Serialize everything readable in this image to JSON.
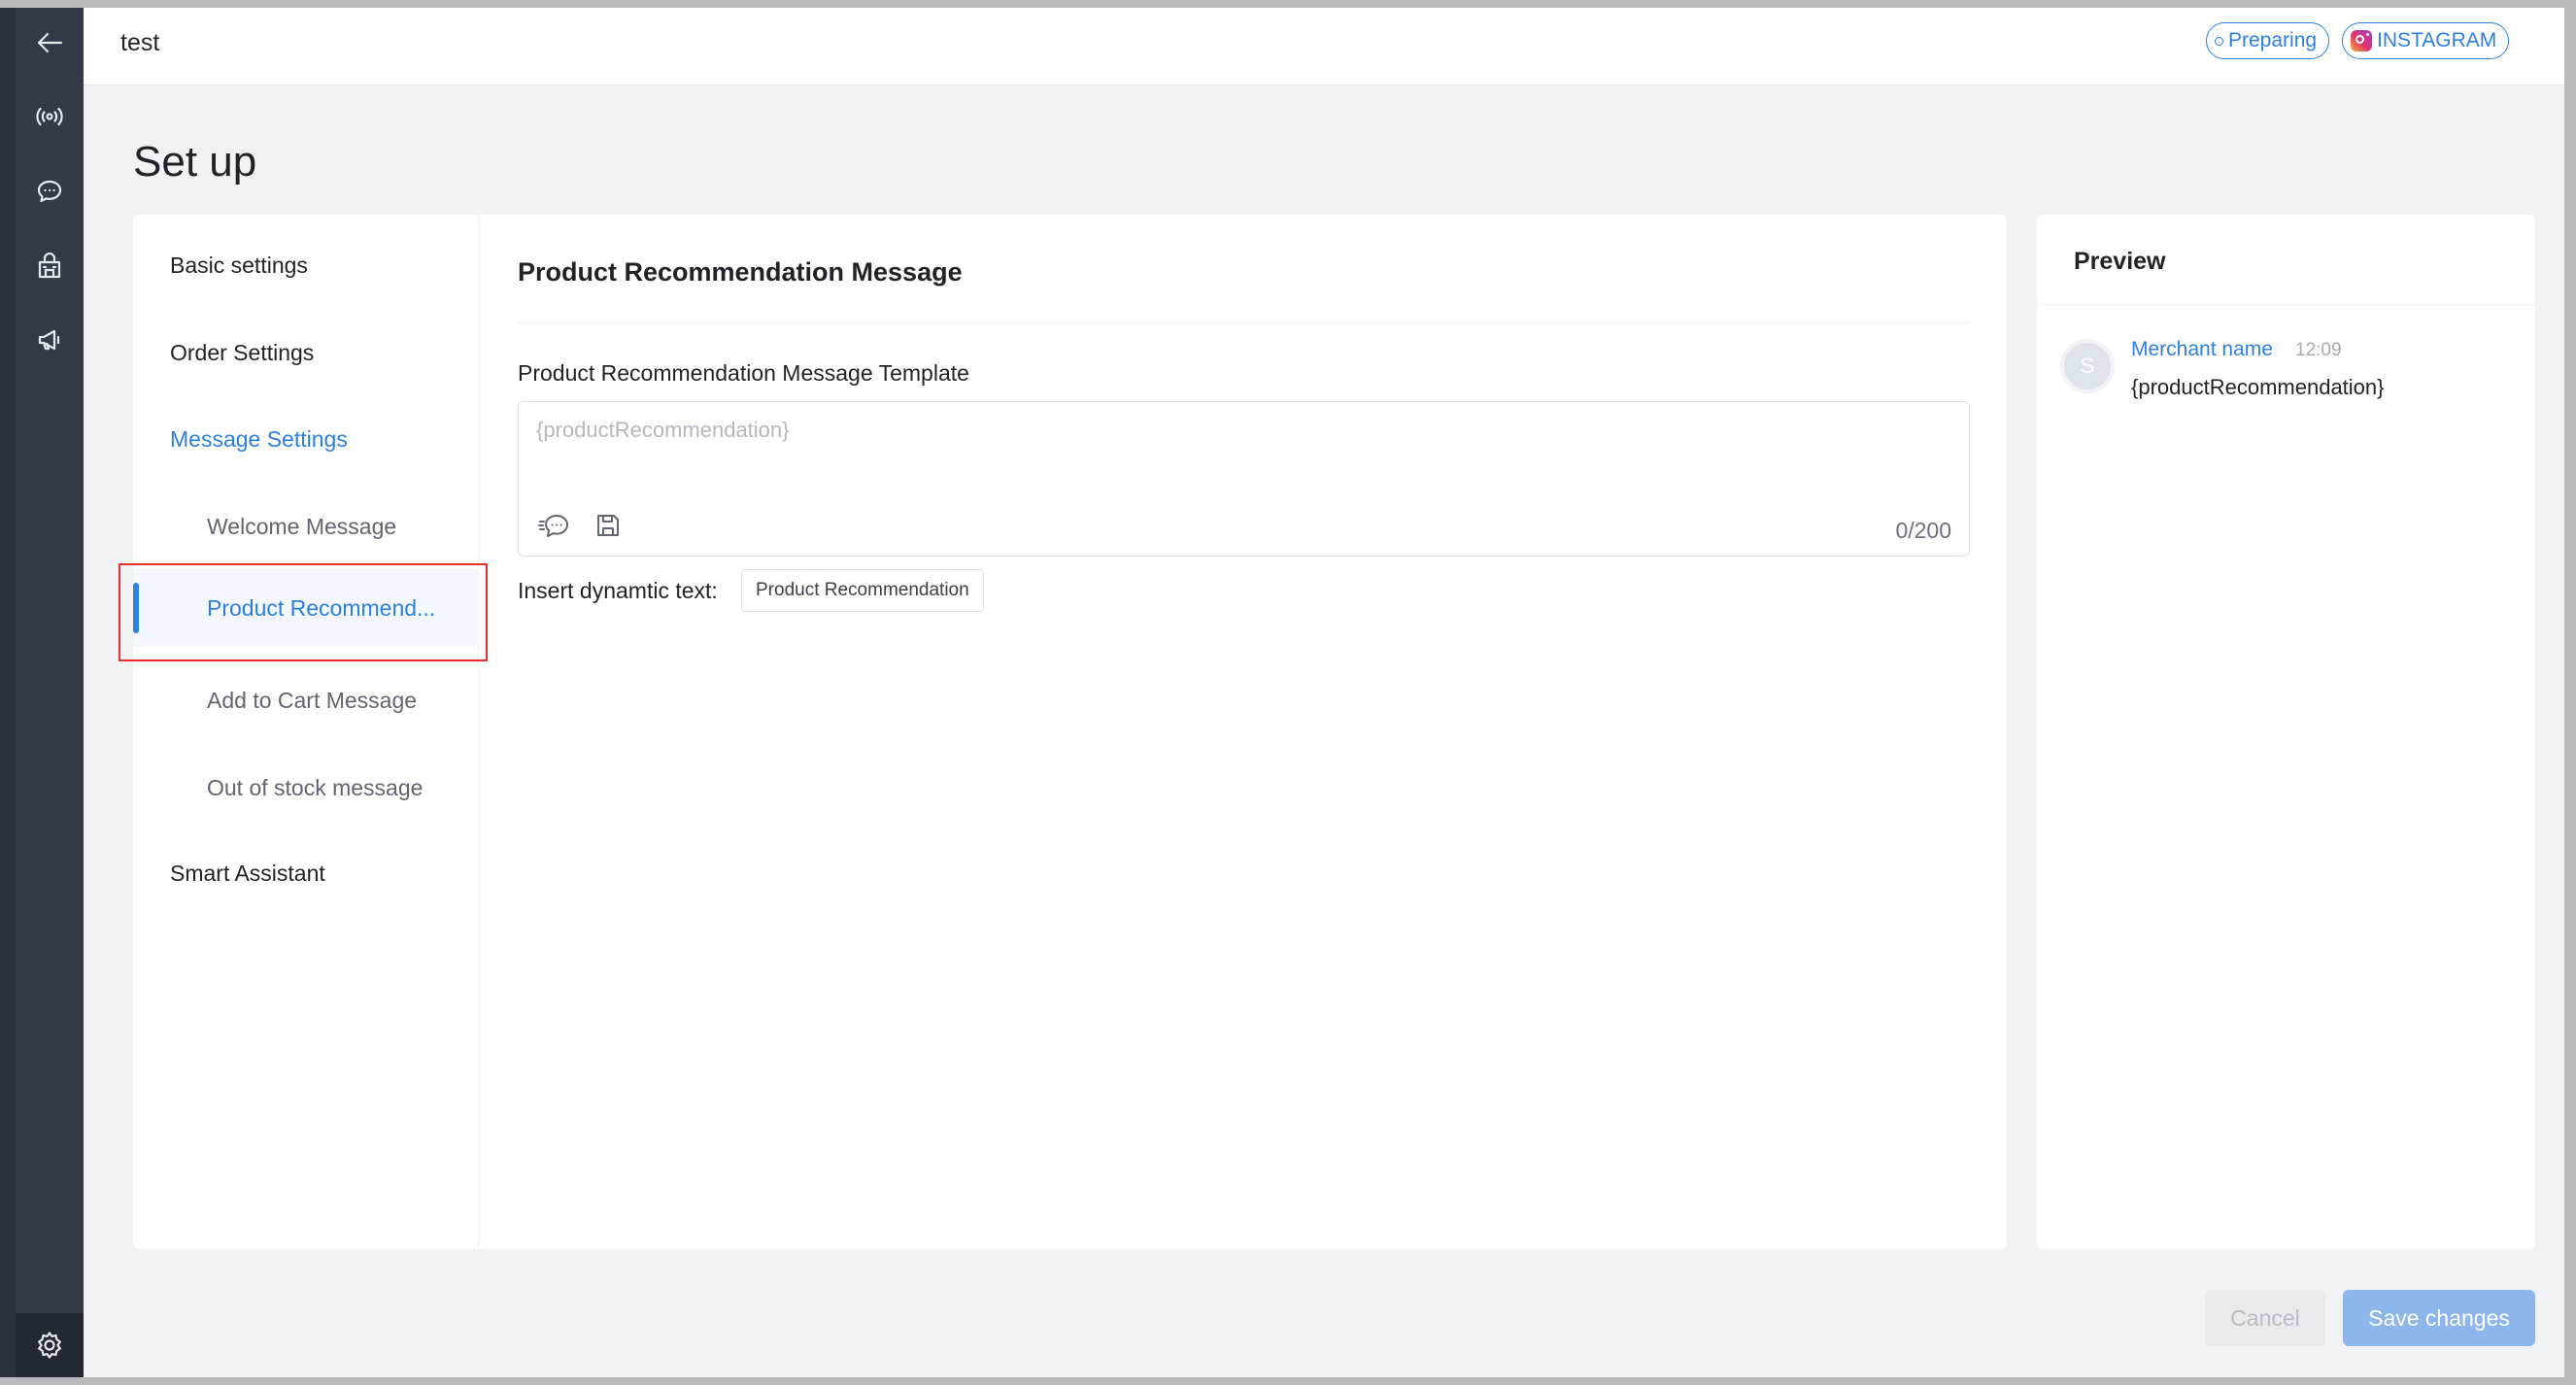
{
  "app": {
    "title": "test",
    "badges": {
      "status": "Preparing",
      "channel": "INSTAGRAM"
    }
  },
  "rail": {
    "icons": [
      "back-arrow-icon",
      "broadcast-icon",
      "chat-icon",
      "store-icon",
      "megaphone-icon",
      "settings-gear-icon"
    ]
  },
  "page": {
    "heading": "Set up"
  },
  "nav": {
    "items": [
      {
        "label": "Basic settings",
        "level": "top"
      },
      {
        "label": "Order Settings",
        "level": "top"
      },
      {
        "label": "Message Settings",
        "level": "top",
        "state": "expanded"
      },
      {
        "label": "Welcome Message",
        "level": "sub"
      },
      {
        "label": "Product Recommend...",
        "level": "sub",
        "state": "selected"
      },
      {
        "label": "Add to Cart Message",
        "level": "sub"
      },
      {
        "label": "Out of stock message",
        "level": "sub"
      },
      {
        "label": "Smart Assistant",
        "level": "top"
      }
    ]
  },
  "editor": {
    "section_title": "Product Recommendation Message",
    "field_label": "Product Recommendation Message Template",
    "template_value": "",
    "template_placeholder": "{productRecommendation}",
    "tools": [
      "quick-reply-icon",
      "save-template-icon"
    ],
    "counter": "0/200",
    "insert_label": "Insert dynamtic text:",
    "insert_chips": [
      "Product Recommendation"
    ]
  },
  "preview": {
    "title": "Preview",
    "avatar_initial": "S",
    "merchant_name": "Merchant name",
    "time": "12:09",
    "message": "{productRecommendation}"
  },
  "actions": {
    "cancel": "Cancel",
    "save": "Save changes"
  },
  "colors": {
    "accent": "#2d7fe0",
    "rail": "#343a47",
    "highlight_box": "#e5332b"
  }
}
